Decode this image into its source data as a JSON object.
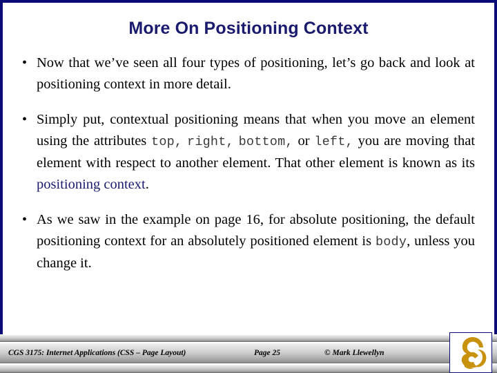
{
  "slide": {
    "title": "More On Positioning Context",
    "title_color": "#1a1a6e",
    "accent_color": "#1a1a6e",
    "border_color": "#0c0c78",
    "background": "#ffffff"
  },
  "bullets": [
    {
      "marker": "•",
      "segments": [
        {
          "text": "Now that we’ve seen all four types of positioning, let’s go back and look at positioning context in more detail.",
          "style": "normal"
        }
      ]
    },
    {
      "marker": "•",
      "segments": [
        {
          "text": "Simply put, contextual positioning means that when you move an element using the attributes ",
          "style": "normal"
        },
        {
          "text": "top,",
          "style": "code"
        },
        {
          "text": "  ",
          "style": "normal"
        },
        {
          "text": "right,",
          "style": "code"
        },
        {
          "text": " ",
          "style": "normal"
        },
        {
          "text": "bottom,",
          "style": "code"
        },
        {
          "text": " or ",
          "style": "normal"
        },
        {
          "text": "left,",
          "style": "code"
        },
        {
          "text": " you are moving that element with respect to another element.  That other element is known as its ",
          "style": "normal"
        },
        {
          "text": "positioning context",
          "style": "accent"
        },
        {
          "text": ".",
          "style": "normal"
        }
      ]
    },
    {
      "marker": "•",
      "segments": [
        {
          "text": "As we saw in the example on page 16, for absolute positioning, the default positioning context for an absolutely positioned element is ",
          "style": "normal"
        },
        {
          "text": "body",
          "style": "code"
        },
        {
          "text": ", unless you change it.",
          "style": "normal"
        }
      ]
    }
  ],
  "footer": {
    "course": "CGS 3175: Internet Applications (CSS – Page Layout)",
    "page": "Page 25",
    "copyright": "© Mark Llewellyn",
    "logo_name": "ucf-pegasus-logo",
    "logo_color": "#c8920d"
  }
}
